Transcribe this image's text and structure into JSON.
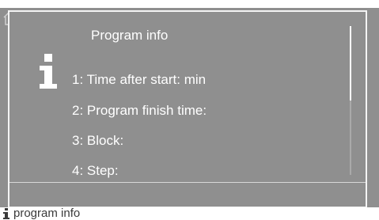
{
  "dialog": {
    "title": "Program info",
    "items": [
      "1:  Time after start:  min",
      "2:  Program finish time:",
      "3:  Block:",
      "4:  Step:"
    ],
    "icon": "info-icon"
  },
  "footer": {
    "icon": "info-icon",
    "label": "program info"
  },
  "background": {
    "icon": "home-icon"
  },
  "colors": {
    "background": "#8f8f8f",
    "text": "#ffffff",
    "border": "#f4f4f4"
  }
}
